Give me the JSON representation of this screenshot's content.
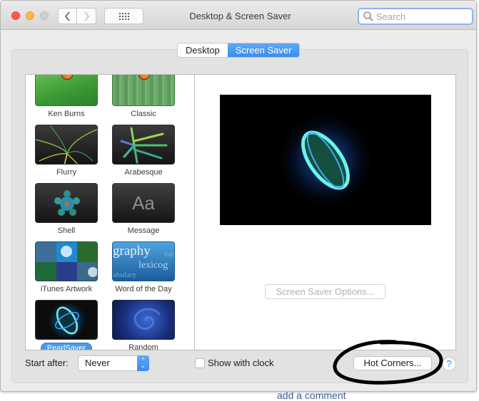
{
  "window": {
    "title": "Desktop & Screen Saver",
    "search_placeholder": "Search",
    "nav": {
      "back_icon": "chevron-left",
      "forward_icon": "chevron-right",
      "grid_icon": "show-all-grid"
    }
  },
  "tabs": [
    {
      "label": "Desktop",
      "active": false
    },
    {
      "label": "Screen Saver",
      "active": true
    }
  ],
  "screen_savers": [
    {
      "name": "Ken Burns",
      "selected": false
    },
    {
      "name": "Classic",
      "selected": false
    },
    {
      "name": "Flurry",
      "selected": false
    },
    {
      "name": "Arabesque",
      "selected": false
    },
    {
      "name": "Shell",
      "selected": false
    },
    {
      "name": "Message",
      "selected": false,
      "thumb_text": "Aa"
    },
    {
      "name": "iTunes Artwork",
      "selected": false
    },
    {
      "name": "Word of the Day",
      "selected": false,
      "thumb_words": [
        "graphy",
        "lexicog",
        "abulary",
        "voc"
      ]
    },
    {
      "name": "PearlSaver",
      "selected": true
    },
    {
      "name": "Random",
      "selected": false
    }
  ],
  "preview": {
    "options_button": "Screen Saver Options...",
    "options_enabled": false
  },
  "footer": {
    "start_after_label": "Start after:",
    "start_after_value": "Never",
    "show_clock_label": "Show with clock",
    "show_clock_checked": false,
    "hot_corners_button": "Hot Corners...",
    "help_button": "?"
  },
  "background_text": "add a comment",
  "colors": {
    "accent": "#3b8cf1",
    "selection": "#4a9ae6",
    "close": "#fc5753",
    "minimize": "#fdbc40"
  }
}
